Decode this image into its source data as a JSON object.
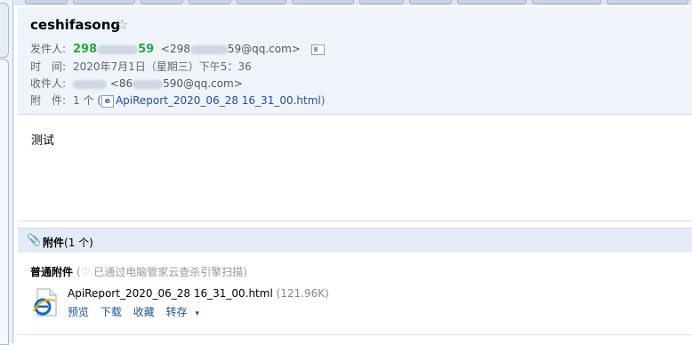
{
  "header": {
    "subject": "ceshifasong",
    "star": "☆",
    "sender_label": "发件人:",
    "sender_name_prefix": "298",
    "sender_name_suffix": "59",
    "sender_addr_prefix": "<298",
    "sender_addr_suffix": "59@qq.com>",
    "time_label": "时　间:",
    "time_value": "2020年7月1日（星期三）下午5：36",
    "recipient_label": "收件人:",
    "recipient_addr_prefix": "<86",
    "recipient_addr_suffix": "590@qq.com>",
    "attachment_label": "附　件:",
    "attachment_count": "1 个 (",
    "attachment_file": "ApiReport_2020_06_28 16_31_00.html",
    "attachment_close": ")"
  },
  "body": {
    "text": "测试"
  },
  "attachments": {
    "title_bold": "附件",
    "title_count": "(1 个)",
    "normal_label": "普通附件",
    "scan_note": "已通过电脑管家云查杀引擎扫描)",
    "scan_open": "(",
    "file_name": "ApiReport_2020_06_28 16_31_00.html",
    "file_size": "(121.96K)",
    "actions": {
      "preview": "预览",
      "download": "下载",
      "favorite": "收藏",
      "forward": "转存"
    }
  },
  "colors": {
    "header_bg": "#eff3fa",
    "sender_green": "#28a745",
    "link_blue": "#1e5494",
    "attach_bar_bg": "#e3ebf6"
  },
  "icons": [
    "star-icon",
    "contact-card-icon",
    "ie-file-icon",
    "paperclip-icon",
    "shield-icon",
    "chevron-down-icon"
  ]
}
